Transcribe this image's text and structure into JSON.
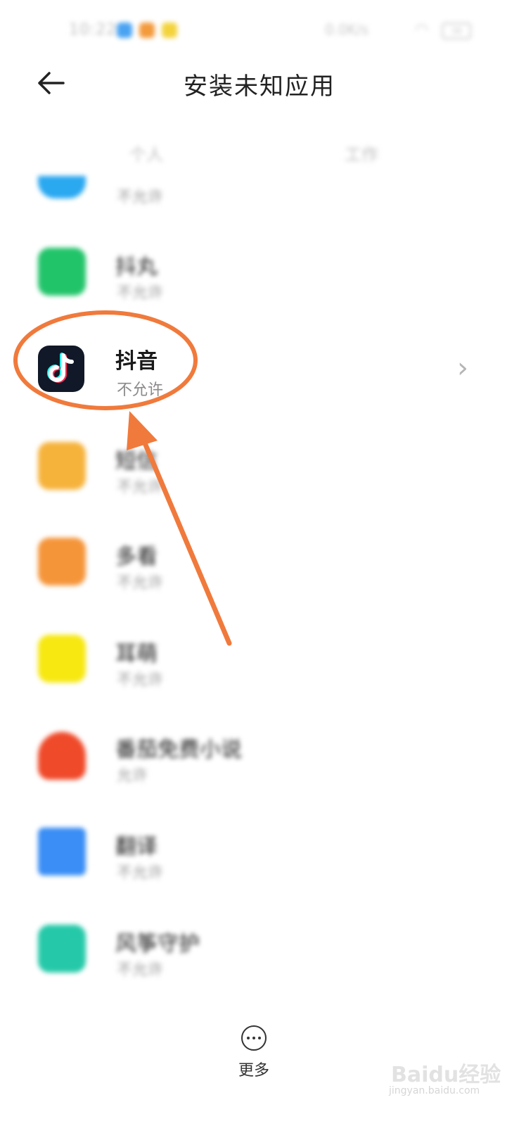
{
  "status_bar": {
    "time": "10:22",
    "net_speed": "0.0K/s",
    "battery": "38"
  },
  "header": {
    "title": "安装未知应用"
  },
  "tabs": [
    "个人",
    "工作"
  ],
  "apps": [
    {
      "name": "",
      "status": "不允许",
      "icon": "app-icon",
      "color": "#2aa8f0"
    },
    {
      "name": "抖丸",
      "status": "不允许",
      "icon": "doujuan-icon",
      "color": "#22c46a"
    },
    {
      "name": "抖音",
      "status": "不允许",
      "icon": "tiktok-icon",
      "color": "#111827"
    },
    {
      "name": "短信",
      "status": "不允许",
      "icon": "message-icon",
      "color": "#f6b33c"
    },
    {
      "name": "多看",
      "status": "不允许",
      "icon": "duokan-icon",
      "color": "#f5953a"
    },
    {
      "name": "耳萌",
      "status": "不允许",
      "icon": "ermeng-icon",
      "color": "#f7e812"
    },
    {
      "name": "番茄免费小说",
      "status": "允许",
      "icon": "fanqie-icon",
      "color": "#ef4a2a"
    },
    {
      "name": "翻译",
      "status": "不允许",
      "icon": "translate-icon",
      "color": "#3a8ef5"
    },
    {
      "name": "风筝守护",
      "status": "不允许",
      "icon": "kite-guard-icon",
      "color": "#25c9a9"
    }
  ],
  "more": {
    "label": "更多"
  },
  "watermark": {
    "text": "Baidu经验",
    "sub": "jingyan.baidu.com"
  },
  "annotation_color": "#f07a3c"
}
